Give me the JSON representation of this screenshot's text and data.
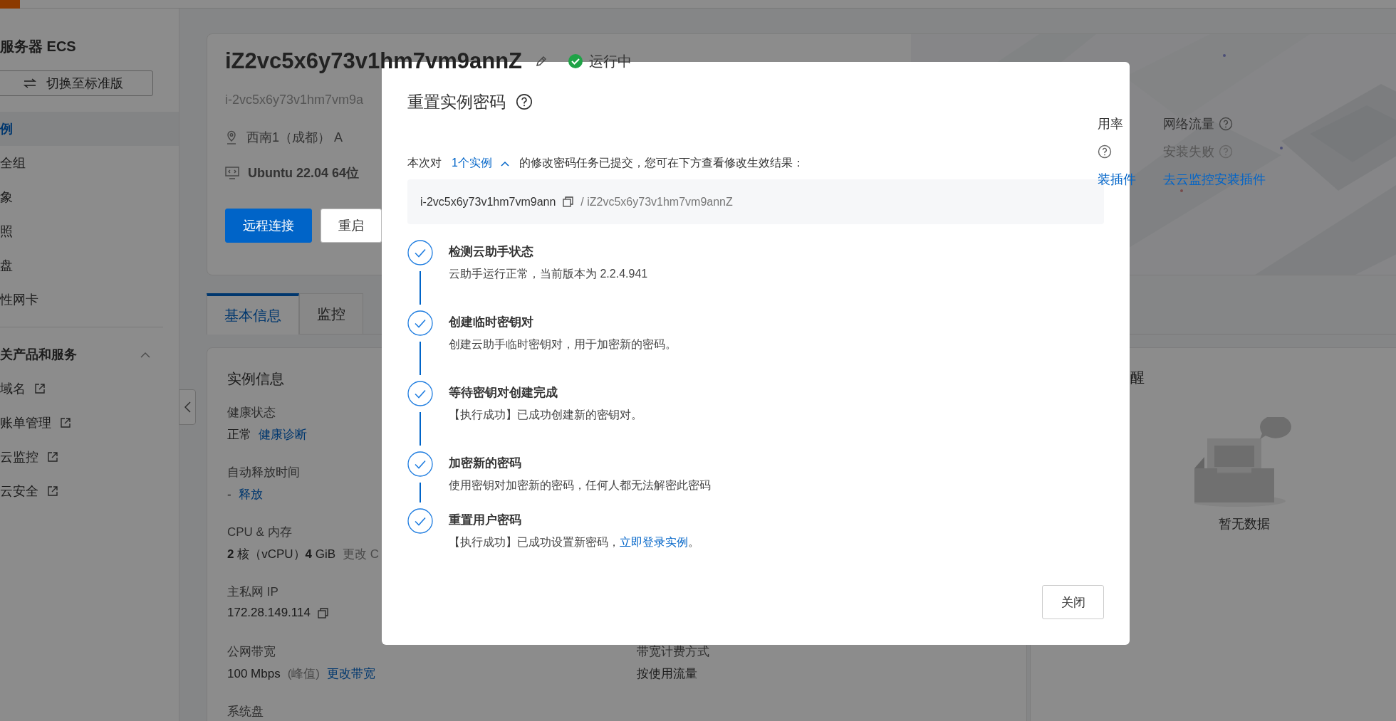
{
  "sidebar": {
    "title": "服务器 ECS",
    "switch_button": "切换至标准版",
    "items": [
      {
        "label": "例",
        "selected": true
      },
      {
        "label": "全组",
        "selected": false
      },
      {
        "label": "象",
        "selected": false
      },
      {
        "label": "照",
        "selected": false
      },
      {
        "label": "盘",
        "selected": false
      },
      {
        "label": "性网卡",
        "selected": false
      }
    ],
    "section": {
      "title": "关产品和服务",
      "expanded": true,
      "links": [
        "域名",
        "账单管理",
        "云监控",
        "云安全"
      ]
    }
  },
  "header": {
    "name": "iZ2vc5x6y73v1hm7vm9annZ",
    "status": "运行中",
    "instance_id": "i-2vc5x6y73v1hm7vm9a",
    "zone": "西南1（成都） A",
    "os": "Ubuntu 22.04 64位",
    "buttons": [
      {
        "label": "远程连接",
        "kind": "primary"
      },
      {
        "label": "重启",
        "kind": "default"
      }
    ],
    "metrics": [
      {
        "title": "用率",
        "title_help": false,
        "state_help": true,
        "link": "装插件"
      },
      {
        "title": "网络流量",
        "title_help": true,
        "state": "安装失败",
        "state_help": true,
        "link": "去云监控安装插件"
      }
    ]
  },
  "tabs": [
    {
      "label": "基本信息",
      "selected": true
    },
    {
      "label": "监控",
      "selected": false
    }
  ],
  "instance_info": {
    "title": "实例信息",
    "rows": [
      [
        {
          "label": "健康状态",
          "value": "正常",
          "link": "健康诊断"
        }
      ],
      [
        {
          "label": "自动释放时间",
          "value": "-",
          "link": "释放"
        }
      ],
      [
        {
          "label": "CPU & 内存",
          "value": "**2** 核（vCPU）**4** GiB",
          "note": "更改 C"
        }
      ],
      [
        {
          "label": "主私网 IP",
          "value": "172.28.149.114",
          "copyable": true
        }
      ],
      [
        {
          "label": "公网带宽",
          "value": "100 Mbps",
          "note": "(峰值)",
          "link": "更改带宽"
        },
        {
          "label": "带宽计费方式",
          "value": "按使用流量"
        }
      ],
      [
        {
          "label": "系统盘"
        }
      ]
    ]
  },
  "side_panel": {
    "title": "醒",
    "empty_text": "暂无数据"
  },
  "dialog": {
    "title": "重置实例密码",
    "intro": {
      "before": "本次对",
      "link": "1个实例",
      "expanded": true,
      "after": "的修改密码任务已提交，您可在下方查看修改生效结果："
    },
    "instance": {
      "id": "i-2vc5x6y73v1hm7vm9ann",
      "name": "/ iZ2vc5x6y73v1hm7vm9annZ"
    },
    "steps": [
      {
        "title": "检测云助手状态",
        "description": "云助手运行正常，当前版本为 2.2.4.941",
        "done": true
      },
      {
        "title": "创建临时密钥对",
        "description": "创建云助手临时密钥对，用于加密新的密码。",
        "done": true
      },
      {
        "title": "等待密钥对创建完成",
        "description": "【执行成功】已成功创建新的密钥对。",
        "done": true
      },
      {
        "title": "加密新的密码",
        "description": "使用密钥对加密新的密码，任何人都无法解密此密码",
        "done": true
      },
      {
        "title": "重置用户密码",
        "description": "【执行成功】已成功设置新密码，",
        "link": "立即登录实例",
        "tail": "。",
        "done": true
      }
    ],
    "close_button": "关闭"
  }
}
